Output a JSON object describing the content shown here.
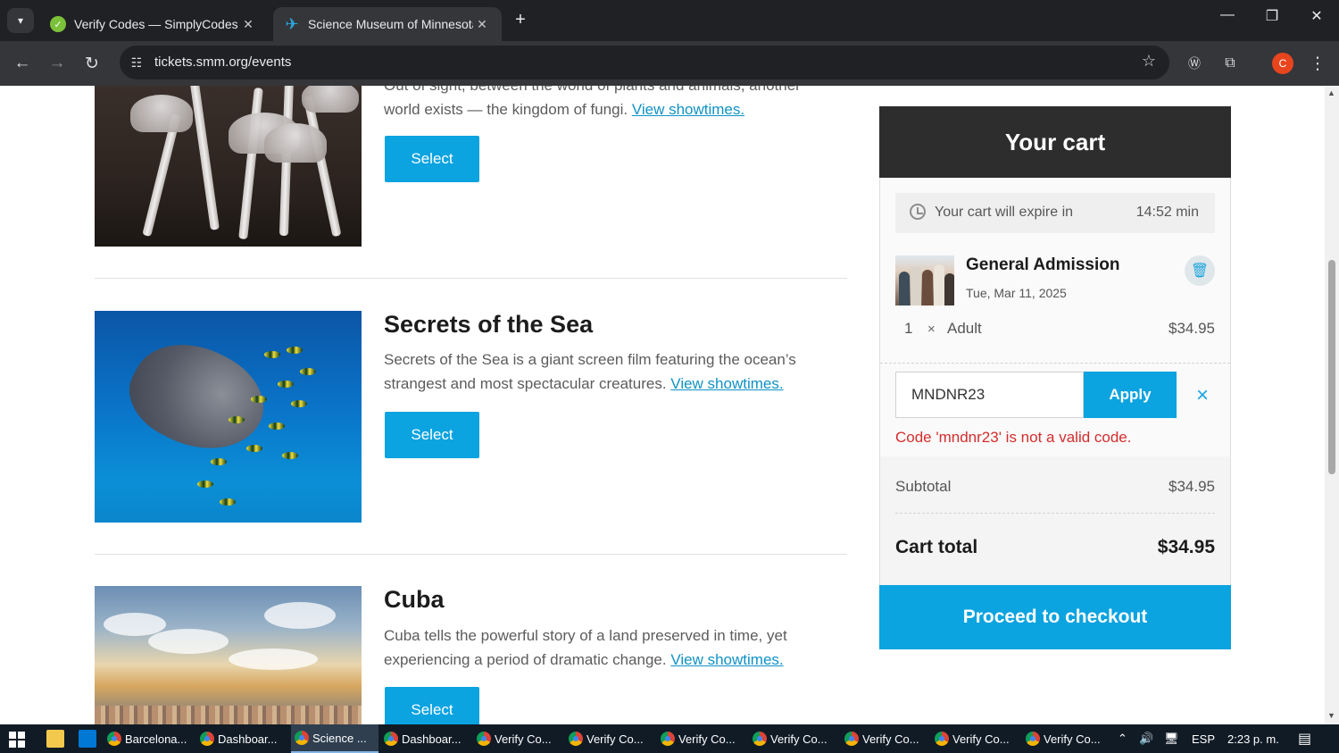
{
  "browser": {
    "tabs": [
      {
        "title": "Verify Codes — SimplyCodes",
        "active": false
      },
      {
        "title": "Science Museum of Minnesota",
        "active": true
      }
    ],
    "url": "tickets.smm.org/events",
    "avatar_letter": "C",
    "window_controls": [
      "—",
      "❐",
      "✕"
    ]
  },
  "events": [
    {
      "title": "",
      "description_start": "Out of sight, between the world of plants and animals, another world exists — the kingdom of fungi.",
      "link": "View showtimes.",
      "button": "Select"
    },
    {
      "title": "Secrets of the Sea",
      "description_start": "Secrets of the Sea is a giant screen film featuring the ocean’s strangest and most spectacular creatures.",
      "link": "View showtimes.",
      "button": "Select"
    },
    {
      "title": "Cuba",
      "description_start": "Cuba tells the powerful story of a land preserved in time, yet experiencing a period of dramatic change.",
      "link": "View showtimes.",
      "button": "Select"
    }
  ],
  "cart": {
    "header": "Your cart",
    "expire_label": "Your cart will expire in",
    "expire_time": "14:52 min",
    "item": {
      "title": "General Admission",
      "date": "Tue, Mar 11, 2025",
      "quantity": "1",
      "times_symbol": "×",
      "ticket_type": "Adult",
      "price": "$34.95"
    },
    "promo": {
      "value": "MNDNR23",
      "apply_label": "Apply",
      "clear_symbol": "×",
      "error": "Code 'mndnr23' is not a valid code."
    },
    "subtotal_label": "Subtotal",
    "subtotal_value": "$34.95",
    "total_label": "Cart total",
    "total_value": "$34.95",
    "checkout_label": "Proceed to checkout"
  },
  "taskbar": {
    "items": [
      "Barcelona...",
      "Dashboar...",
      "Science ...",
      "Dashboar...",
      "Verify Co...",
      "Verify Co...",
      "Verify Co...",
      "Verify Co...",
      "Verify Co...",
      "Verify Co...",
      "Verify Co..."
    ],
    "language": "ESP",
    "time": "2:23 p. m."
  },
  "colors": {
    "accent": "#0ba3e0",
    "error": "#d42d2d",
    "dark_header": "#2d2d2d"
  }
}
